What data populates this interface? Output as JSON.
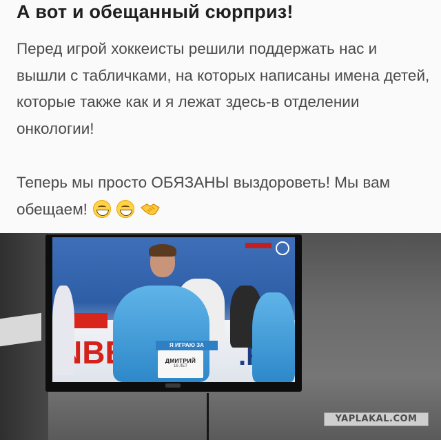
{
  "post": {
    "title": "А вот и обещанный сюрприз!",
    "paragraph1": "Перед игрой хоккеисты решили поддержать нас и вышли с табличками, на которых написаны имена детей, которые также как и я лежат здесь-в отделении онкологии!",
    "paragraph2": "Теперь мы просто ОБЯЗАНЫ выздороветь! Мы вам обещаем!",
    "emojis": [
      "grinning-face-icon",
      "grinning-face-icon",
      "handshake-icon"
    ]
  },
  "photo": {
    "description_icon": "tv-hockey-photo",
    "sign_banner": "Я ИГРАЮ ЗА",
    "sign_name": "ДМИТРИЙ",
    "sign_age": "16 ЛЕТ",
    "ad_left": "NBE",
    "ad_right": ".R"
  },
  "watermark": "YAPLAKAL.COM",
  "colors": {
    "title": "#1f1f1f",
    "text": "#4a4a4a",
    "jersey": "#3a9ad9"
  }
}
